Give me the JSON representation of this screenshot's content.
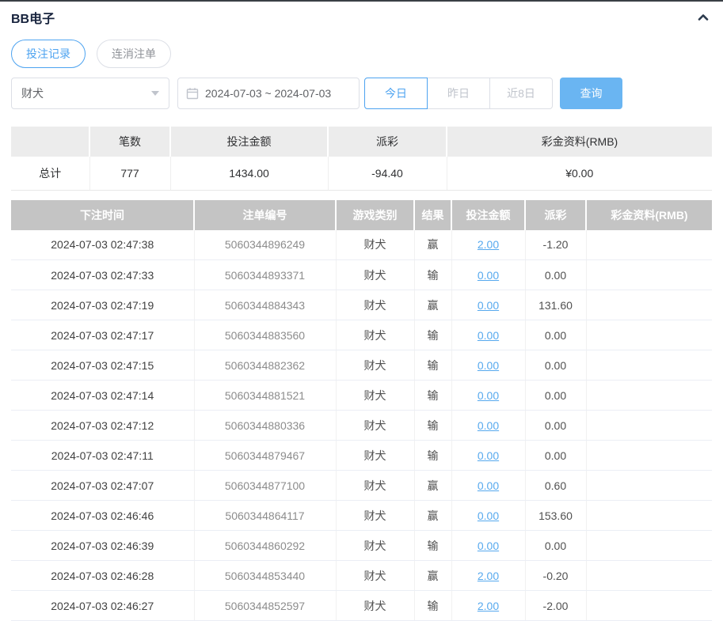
{
  "panel": {
    "title": "BB电子"
  },
  "icons": {
    "collapse": "chevron-up-icon",
    "select_arrow": "chevron-down-icon",
    "date": "calendar-icon"
  },
  "colors": {
    "accent": "#4da3f0",
    "search_button": "#6ab5f2",
    "link": "#57a9ee",
    "negative": "#f56c6c",
    "table_header_bg": "#c4c4c4",
    "summary_header_bg": "#ececec"
  },
  "tabs": [
    {
      "label": "投注记录",
      "active": true
    },
    {
      "label": "连消注单",
      "active": false
    }
  ],
  "filters": {
    "game_select": {
      "value": "财犬"
    },
    "date_range": {
      "value": "2024-07-03 ~ 2024-07-03"
    },
    "quick_ranges": [
      {
        "label": "今日",
        "active": true
      },
      {
        "label": "昨日",
        "active": false
      },
      {
        "label": "近8日",
        "active": false
      }
    ],
    "search_label": "查询"
  },
  "summary": {
    "headers": [
      "",
      "笔数",
      "投注金额",
      "派彩",
      "彩金资料(RMB)"
    ],
    "row": {
      "label": "总计",
      "count": "777",
      "bet_amount": "1434.00",
      "payout": "-94.40",
      "bonus": "¥0.00"
    }
  },
  "table": {
    "headers": [
      "下注时间",
      "注单编号",
      "游戏类别",
      "结果",
      "投注金额",
      "派彩",
      "彩金资料(RMB)"
    ],
    "rows": [
      {
        "time": "2024-07-03 02:47:38",
        "order_id": "5060344896249",
        "game": "财犬",
        "result": "赢",
        "bet": "2.00",
        "payout": "-1.20",
        "bonus": ""
      },
      {
        "time": "2024-07-03 02:47:33",
        "order_id": "5060344893371",
        "game": "财犬",
        "result": "输",
        "bet": "0.00",
        "payout": "0.00",
        "bonus": ""
      },
      {
        "time": "2024-07-03 02:47:19",
        "order_id": "5060344884343",
        "game": "财犬",
        "result": "赢",
        "bet": "0.00",
        "payout": "131.60",
        "bonus": ""
      },
      {
        "time": "2024-07-03 02:47:17",
        "order_id": "5060344883560",
        "game": "财犬",
        "result": "输",
        "bet": "0.00",
        "payout": "0.00",
        "bonus": ""
      },
      {
        "time": "2024-07-03 02:47:15",
        "order_id": "5060344882362",
        "game": "财犬",
        "result": "输",
        "bet": "0.00",
        "payout": "0.00",
        "bonus": ""
      },
      {
        "time": "2024-07-03 02:47:14",
        "order_id": "5060344881521",
        "game": "财犬",
        "result": "输",
        "bet": "0.00",
        "payout": "0.00",
        "bonus": ""
      },
      {
        "time": "2024-07-03 02:47:12",
        "order_id": "5060344880336",
        "game": "财犬",
        "result": "输",
        "bet": "0.00",
        "payout": "0.00",
        "bonus": ""
      },
      {
        "time": "2024-07-03 02:47:11",
        "order_id": "5060344879467",
        "game": "财犬",
        "result": "输",
        "bet": "0.00",
        "payout": "0.00",
        "bonus": ""
      },
      {
        "time": "2024-07-03 02:47:07",
        "order_id": "5060344877100",
        "game": "财犬",
        "result": "赢",
        "bet": "0.00",
        "payout": "0.60",
        "bonus": ""
      },
      {
        "time": "2024-07-03 02:46:46",
        "order_id": "5060344864117",
        "game": "财犬",
        "result": "赢",
        "bet": "0.00",
        "payout": "153.60",
        "bonus": ""
      },
      {
        "time": "2024-07-03 02:46:39",
        "order_id": "5060344860292",
        "game": "财犬",
        "result": "输",
        "bet": "0.00",
        "payout": "0.00",
        "bonus": ""
      },
      {
        "time": "2024-07-03 02:46:28",
        "order_id": "5060344853440",
        "game": "财犬",
        "result": "赢",
        "bet": "2.00",
        "payout": "-0.20",
        "bonus": ""
      },
      {
        "time": "2024-07-03 02:46:27",
        "order_id": "5060344852597",
        "game": "财犬",
        "result": "输",
        "bet": "2.00",
        "payout": "-2.00",
        "bonus": ""
      }
    ]
  }
}
